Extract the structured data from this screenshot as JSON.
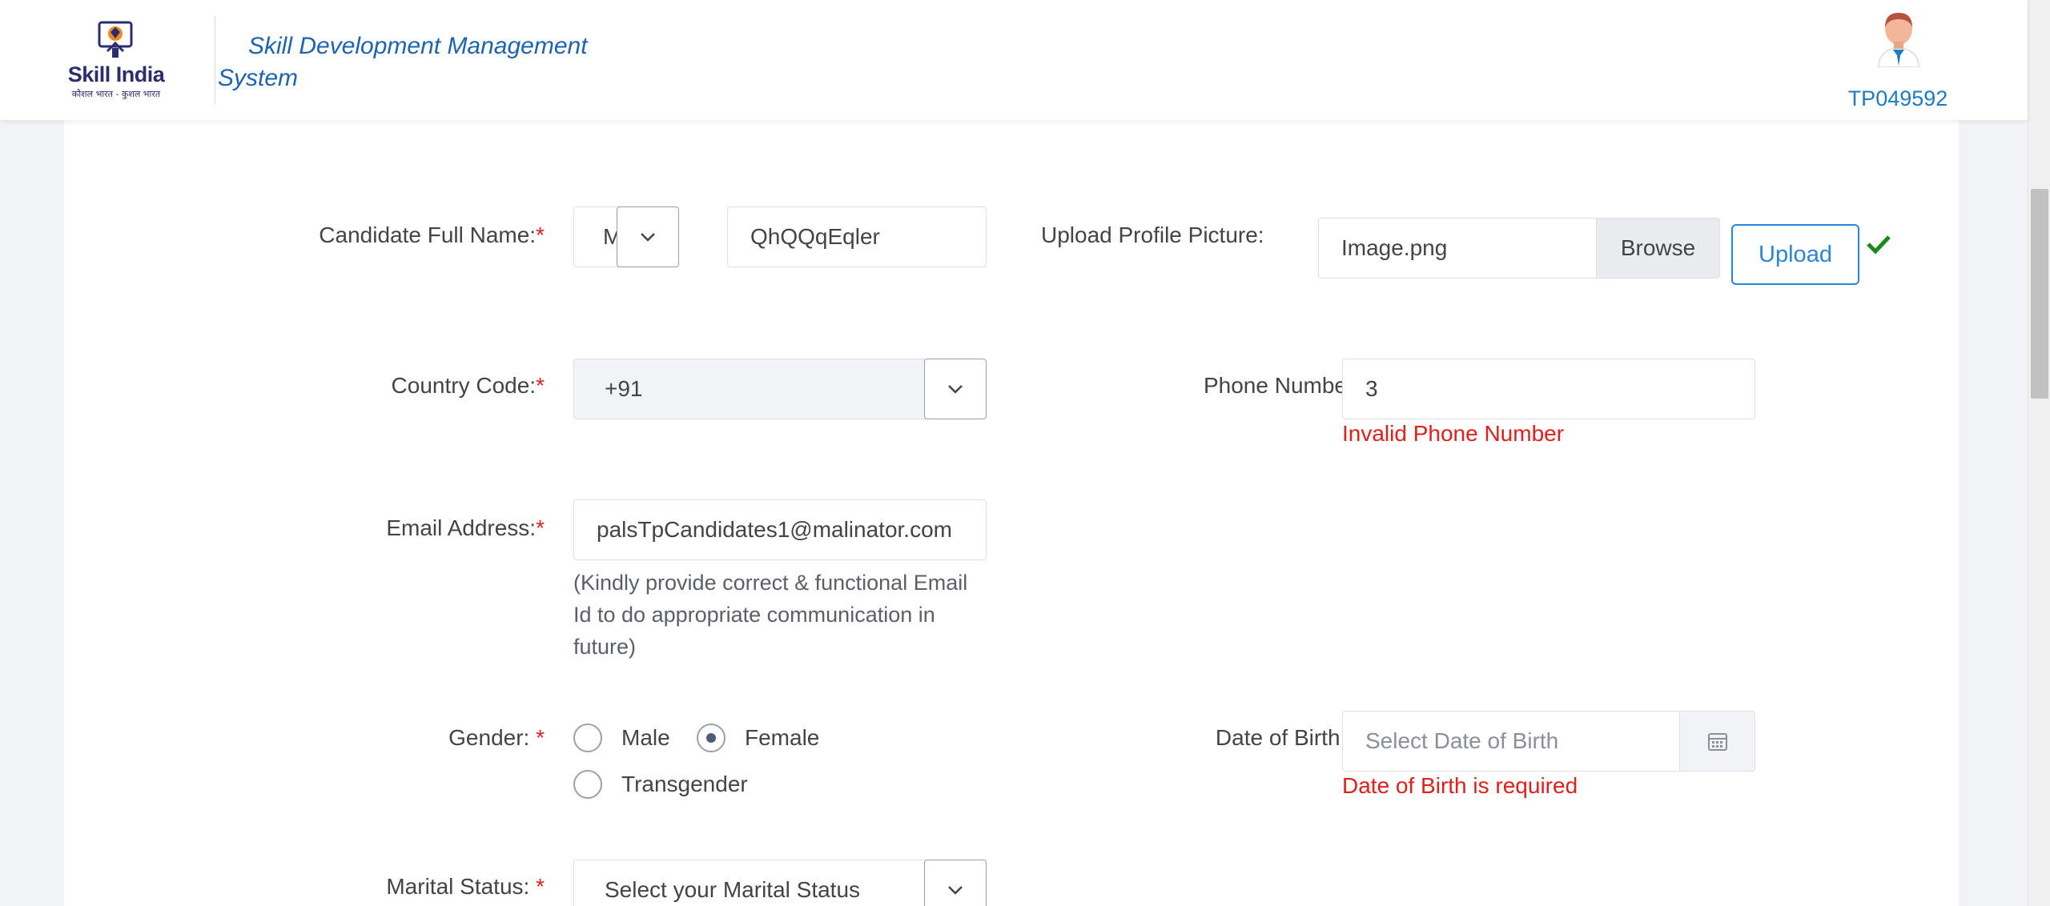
{
  "header": {
    "logo_text": "Skill India",
    "logo_subtext": "कौशल भारत - कुशल भारत",
    "app_title": "Skill Development Management System",
    "user_id": "TP049592"
  },
  "form": {
    "full_name": {
      "label": "Candidate Full Name:",
      "required": "*",
      "title_value": "M",
      "name_value": "QhQQqEqler"
    },
    "profile_picture": {
      "label": "Upload Profile Picture:",
      "file_value": "Image.png",
      "browse_label": "Browse",
      "upload_label": "Upload",
      "status_icon": "check-icon",
      "status_color": "#1a8a1a"
    },
    "country_code": {
      "label": "Country Code:",
      "required": "*",
      "value": "+91"
    },
    "phone_number": {
      "label": "Phone Number:",
      "required": "*",
      "value": "3",
      "error": "Invalid Phone Number"
    },
    "email": {
      "label": "Email Address:",
      "required": "*",
      "value": "palsTpCandidates1@malinator.com",
      "hint": "(Kindly provide correct & functional Email Id to do appropriate communication in future)"
    },
    "gender": {
      "label": "Gender: ",
      "required": "*",
      "options": [
        "Male",
        "Female",
        "Transgender"
      ],
      "selected": "Female"
    },
    "dob": {
      "label": "Date of Birth: ",
      "required": "*",
      "placeholder": "Select Date of Birth",
      "error": "Date of Birth is required"
    },
    "marital_status": {
      "label": "Marital Status: ",
      "required": "*",
      "placeholder": "Select your Marital Status"
    }
  },
  "colors": {
    "required": "#e0201c",
    "error": "#e0201c",
    "accent": "#2a86d8",
    "title": "#1d63b0"
  }
}
